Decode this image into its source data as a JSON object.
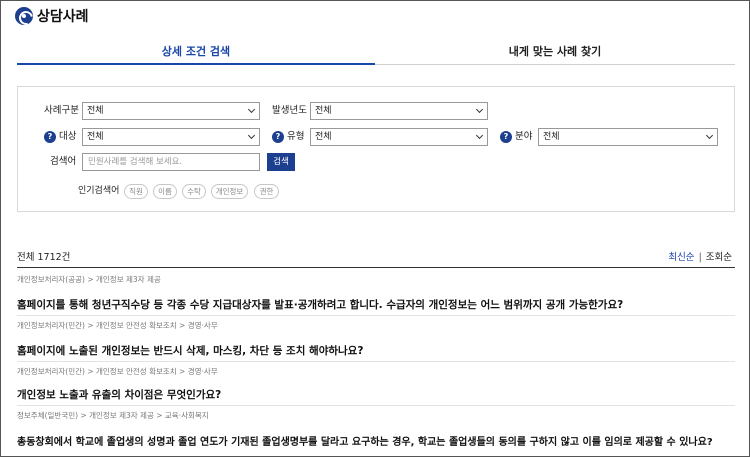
{
  "header": {
    "title": "상담사례"
  },
  "tabs": [
    {
      "label": "상세 조건 검색",
      "active": true
    },
    {
      "label": "내게 맞는 사례 찾기",
      "active": false
    }
  ],
  "filters": {
    "case_type": {
      "label": "사례구분",
      "value": "전체"
    },
    "year": {
      "label": "발생년도",
      "value": "전체"
    },
    "target": {
      "label": "대상",
      "value": "전체"
    },
    "kind": {
      "label": "유형",
      "value": "전체"
    },
    "field": {
      "label": "분야",
      "value": "전체"
    },
    "keyword": {
      "label": "검색어",
      "placeholder": "민원사례를 검색해 보세요.",
      "button": "검색"
    },
    "popular": {
      "label": "인기검색어",
      "items": [
        "직원",
        "이름",
        "수탁",
        "개인정보",
        "권한"
      ]
    }
  },
  "results": {
    "count_label": "전체 1712건",
    "sort": {
      "latest": "최신순",
      "separator": "|",
      "views": "조회순"
    },
    "items": [
      {
        "category": "개인정보처리자(공공) > 개인정보 제3자 제공",
        "question": "홈페이지를 통해 청년구직수당 등 각종 수당 지급대상자를 발표·공개하려고 합니다. 수급자의 개인정보는 어느 범위까지 공개 가능한가요?"
      },
      {
        "category": "개인정보처리자(민간) > 개인정보 안전성 확보조치 > 경영·사무",
        "question": "홈페이지에 노출된 개인정보는 반드시 삭제, 마스킹, 차단 등 조치 해야하나요?"
      },
      {
        "category": "개인정보처리자(민간) > 개인정보 안전성 확보조치 > 경영·사무",
        "question": "개인정보 노출과 유출의 차이점은 무엇인가요?"
      },
      {
        "category": "정보주체(일반국민) > 개인정보 제3자 제공 > 교육·사회복지",
        "question": "총동창회에서 학교에 졸업생의 성명과 졸업 연도가 기재된 졸업생명부를 달라고 요구하는 경우, 학교는 졸업생들의 동의를 구하지 않고 이를 임의로 제공할 수 있나요?"
      }
    ]
  },
  "colors": {
    "accent": "#1a46a8",
    "brand": "#1d3f8f"
  },
  "icons": {
    "logo": "privacy-logo-icon",
    "help": "help-icon",
    "dropdown": "chevron-down-icon"
  }
}
